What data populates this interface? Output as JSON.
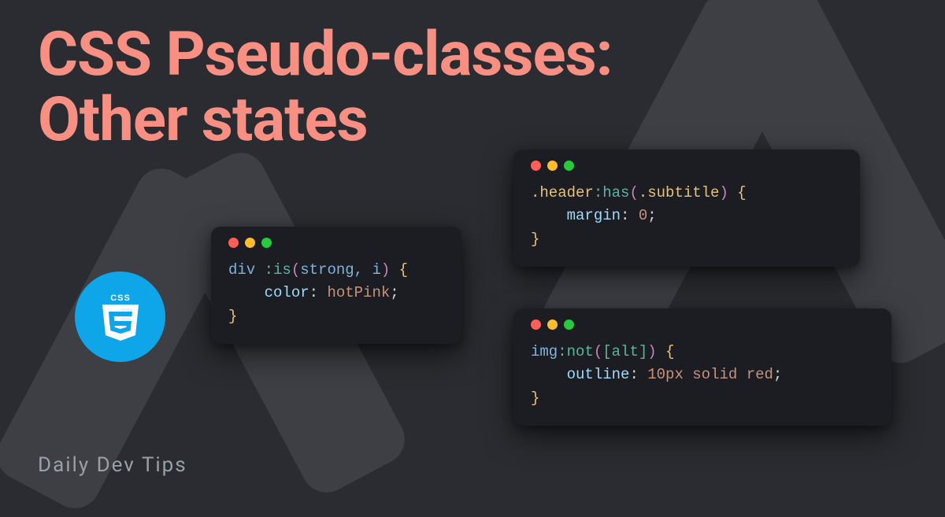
{
  "title_line1": "CSS Pseudo-classes:",
  "title_line2": "Other states",
  "footer": "Daily Dev Tips",
  "badge_text": "CSS",
  "snippets": {
    "is": {
      "selector_tag": "div ",
      "pseudo": ":is",
      "args": "strong, i",
      "prop": "color",
      "value": "hotPink"
    },
    "has": {
      "selector_class": ".header",
      "pseudo": ":has",
      "arg_class": ".subtitle",
      "prop": "margin",
      "value": "0"
    },
    "not": {
      "selector_tag": "img",
      "pseudo": ":not",
      "arg_attr": "[alt]",
      "prop": "outline",
      "value_num": "10px",
      "value_kw1": "solid",
      "value_kw2": "red"
    }
  },
  "colors": {
    "bg": "#2a2c31",
    "accent": "#f78f82",
    "badge": "#0ea5e9",
    "window": "#1b1d22"
  }
}
